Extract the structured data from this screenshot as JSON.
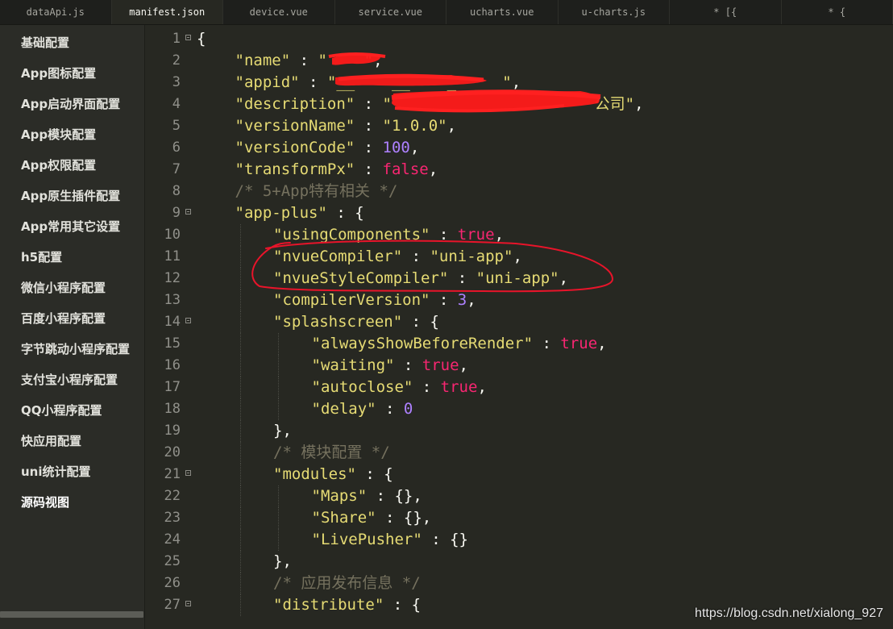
{
  "tabs": [
    {
      "label": "dataApi.js",
      "active": false
    },
    {
      "label": "manifest.json",
      "active": true
    },
    {
      "label": "device.vue",
      "active": false
    },
    {
      "label": "service.vue",
      "active": false
    },
    {
      "label": "ucharts.vue",
      "active": false
    },
    {
      "label": "u-charts.js",
      "active": false
    },
    {
      "label": "* [{",
      "active": false
    },
    {
      "label": "* {",
      "active": false
    }
  ],
  "sidebar": {
    "items": [
      {
        "label": "基础配置"
      },
      {
        "label": "App图标配置"
      },
      {
        "label": "App启动界面配置"
      },
      {
        "label": "App模块配置"
      },
      {
        "label": "App权限配置"
      },
      {
        "label": "App原生插件配置"
      },
      {
        "label": "App常用其它设置"
      },
      {
        "label": "h5配置"
      },
      {
        "label": "微信小程序配置"
      },
      {
        "label": "百度小程序配置"
      },
      {
        "label": "字节跳动小程序配置"
      },
      {
        "label": "支付宝小程序配置"
      },
      {
        "label": "QQ小程序配置"
      },
      {
        "label": "快应用配置"
      },
      {
        "label": "uni统计配置"
      },
      {
        "label": "源码视图",
        "current": true
      }
    ]
  },
  "editor": {
    "lines": [
      {
        "n": "1",
        "fold": true,
        "indent": 0,
        "tokens": [
          [
            "p",
            "{"
          ]
        ]
      },
      {
        "n": "2",
        "indent": 1,
        "tokens": [
          [
            "k",
            "\"name\""
          ],
          [
            "p",
            " : "
          ],
          [
            "s",
            "\"    \""
          ],
          [
            "p",
            ","
          ]
        ]
      },
      {
        "n": "3",
        "indent": 1,
        "tokens": [
          [
            "k",
            "\"appid\""
          ],
          [
            "p",
            " : "
          ],
          [
            "s",
            "\"__    __    _  ___\""
          ],
          [
            "p",
            ","
          ]
        ]
      },
      {
        "n": "4",
        "indent": 1,
        "tokens": [
          [
            "k",
            "\"description\""
          ],
          [
            "p",
            " : "
          ],
          [
            "s",
            "\"                      公司\""
          ],
          [
            "p",
            ","
          ]
        ]
      },
      {
        "n": "5",
        "indent": 1,
        "tokens": [
          [
            "k",
            "\"versionName\""
          ],
          [
            "p",
            " : "
          ],
          [
            "s",
            "\"1.0.0\""
          ],
          [
            "p",
            ","
          ]
        ]
      },
      {
        "n": "6",
        "indent": 1,
        "tokens": [
          [
            "k",
            "\"versionCode\""
          ],
          [
            "p",
            " : "
          ],
          [
            "n",
            "100"
          ],
          [
            "p",
            ","
          ]
        ]
      },
      {
        "n": "7",
        "indent": 1,
        "tokens": [
          [
            "k",
            "\"transformPx\""
          ],
          [
            "p",
            " : "
          ],
          [
            "b",
            "false"
          ],
          [
            "p",
            ","
          ]
        ]
      },
      {
        "n": "8",
        "indent": 1,
        "tokens": [
          [
            "c",
            "/* 5+App特有相关 */"
          ]
        ]
      },
      {
        "n": "9",
        "fold": true,
        "indent": 1,
        "tokens": [
          [
            "k",
            "\"app-plus\""
          ],
          [
            "p",
            " : {"
          ]
        ]
      },
      {
        "n": "10",
        "indent": 2,
        "tokens": [
          [
            "k",
            "\"usingComponents\""
          ],
          [
            "p",
            " : "
          ],
          [
            "b",
            "true"
          ],
          [
            "p",
            ","
          ]
        ]
      },
      {
        "n": "11",
        "indent": 2,
        "tokens": [
          [
            "k",
            "\"nvueCompiler\""
          ],
          [
            "p",
            " : "
          ],
          [
            "s",
            "\"uni-app\""
          ],
          [
            "p",
            ","
          ]
        ]
      },
      {
        "n": "12",
        "indent": 2,
        "tokens": [
          [
            "k",
            "\"nvueStyleCompiler\""
          ],
          [
            "p",
            " : "
          ],
          [
            "s",
            "\"uni-app\""
          ],
          [
            "p",
            ","
          ]
        ]
      },
      {
        "n": "13",
        "indent": 2,
        "tokens": [
          [
            "k",
            "\"compilerVersion\""
          ],
          [
            "p",
            " : "
          ],
          [
            "n",
            "3"
          ],
          [
            "p",
            ","
          ]
        ]
      },
      {
        "n": "14",
        "fold": true,
        "indent": 2,
        "tokens": [
          [
            "k",
            "\"splashscreen\""
          ],
          [
            "p",
            " : {"
          ]
        ]
      },
      {
        "n": "15",
        "indent": 3,
        "tokens": [
          [
            "k",
            "\"alwaysShowBeforeRender\""
          ],
          [
            "p",
            " : "
          ],
          [
            "b",
            "true"
          ],
          [
            "p",
            ","
          ]
        ]
      },
      {
        "n": "16",
        "indent": 3,
        "tokens": [
          [
            "k",
            "\"waiting\""
          ],
          [
            "p",
            " : "
          ],
          [
            "b",
            "true"
          ],
          [
            "p",
            ","
          ]
        ]
      },
      {
        "n": "17",
        "indent": 3,
        "tokens": [
          [
            "k",
            "\"autoclose\""
          ],
          [
            "p",
            " : "
          ],
          [
            "b",
            "true"
          ],
          [
            "p",
            ","
          ]
        ]
      },
      {
        "n": "18",
        "indent": 3,
        "tokens": [
          [
            "k",
            "\"delay\""
          ],
          [
            "p",
            " : "
          ],
          [
            "n",
            "0"
          ]
        ]
      },
      {
        "n": "19",
        "indent": 2,
        "tokens": [
          [
            "p",
            "},"
          ]
        ]
      },
      {
        "n": "20",
        "indent": 2,
        "tokens": [
          [
            "c",
            "/* 模块配置 */"
          ]
        ]
      },
      {
        "n": "21",
        "fold": true,
        "indent": 2,
        "tokens": [
          [
            "k",
            "\"modules\""
          ],
          [
            "p",
            " : {"
          ]
        ]
      },
      {
        "n": "22",
        "indent": 3,
        "tokens": [
          [
            "k",
            "\"Maps\""
          ],
          [
            "p",
            " : {},"
          ]
        ]
      },
      {
        "n": "23",
        "indent": 3,
        "tokens": [
          [
            "k",
            "\"Share\""
          ],
          [
            "p",
            " : {},"
          ]
        ]
      },
      {
        "n": "24",
        "indent": 3,
        "tokens": [
          [
            "k",
            "\"LivePusher\""
          ],
          [
            "p",
            " : {}"
          ]
        ]
      },
      {
        "n": "25",
        "indent": 2,
        "tokens": [
          [
            "p",
            "},"
          ]
        ]
      },
      {
        "n": "26",
        "indent": 2,
        "tokens": [
          [
            "c",
            "/* 应用发布信息 */"
          ]
        ]
      },
      {
        "n": "27",
        "fold": true,
        "indent": 2,
        "tokens": [
          [
            "k",
            "\"distribute\""
          ],
          [
            "p",
            " : {"
          ]
        ]
      }
    ]
  },
  "colors": {
    "keys": "#e6db74",
    "strings": "#e6db74",
    "numbers": "#ae81ff",
    "booleans": "#f92672",
    "comments": "#75715e",
    "annotation": "#e8142a"
  },
  "watermark": "https://blog.csdn.net/xialong_927"
}
